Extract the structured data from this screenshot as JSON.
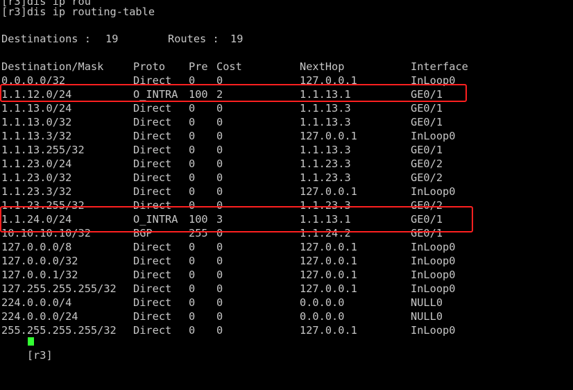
{
  "terminal": {
    "header_lines": [
      "[r3]dis ip rou",
      "[r3]dis ip routing-table"
    ],
    "summary": {
      "destinations_label": "Destinations : ",
      "destinations_value": "19",
      "routes_label": "Routes : ",
      "routes_value": "19"
    },
    "columns": {
      "dest": "Destination/Mask",
      "proto": "Proto",
      "pre": "Pre",
      "cost": "Cost",
      "nexthop": "NextHop",
      "interface": "Interface"
    },
    "rows": [
      {
        "dest": "0.0.0.0/32",
        "proto": "Direct",
        "pre": "0",
        "cost": "0",
        "nexthop": "127.0.0.1",
        "interface": "InLoop0"
      },
      {
        "dest": "1.1.12.0/24",
        "proto": "O_INTRA",
        "pre": "100",
        "cost": "2",
        "nexthop": "1.1.13.1",
        "interface": "GE0/1"
      },
      {
        "dest": "1.1.13.0/24",
        "proto": "Direct",
        "pre": "0",
        "cost": "0",
        "nexthop": "1.1.13.3",
        "interface": "GE0/1"
      },
      {
        "dest": "1.1.13.0/32",
        "proto": "Direct",
        "pre": "0",
        "cost": "0",
        "nexthop": "1.1.13.3",
        "interface": "GE0/1"
      },
      {
        "dest": "1.1.13.3/32",
        "proto": "Direct",
        "pre": "0",
        "cost": "0",
        "nexthop": "127.0.0.1",
        "interface": "InLoop0"
      },
      {
        "dest": "1.1.13.255/32",
        "proto": "Direct",
        "pre": "0",
        "cost": "0",
        "nexthop": "1.1.13.3",
        "interface": "GE0/1"
      },
      {
        "dest": "1.1.23.0/24",
        "proto": "Direct",
        "pre": "0",
        "cost": "0",
        "nexthop": "1.1.23.3",
        "interface": "GE0/2"
      },
      {
        "dest": "1.1.23.0/32",
        "proto": "Direct",
        "pre": "0",
        "cost": "0",
        "nexthop": "1.1.23.3",
        "interface": "GE0/2"
      },
      {
        "dest": "1.1.23.3/32",
        "proto": "Direct",
        "pre": "0",
        "cost": "0",
        "nexthop": "127.0.0.1",
        "interface": "InLoop0"
      },
      {
        "dest": "1.1.23.255/32",
        "proto": "Direct",
        "pre": "0",
        "cost": "0",
        "nexthop": "1.1.23.3",
        "interface": "GE0/2"
      },
      {
        "dest": "1.1.24.0/24",
        "proto": "O_INTRA",
        "pre": "100",
        "cost": "3",
        "nexthop": "1.1.13.1",
        "interface": "GE0/1"
      },
      {
        "dest": "10.10.10.10/32",
        "proto": "BGP",
        "pre": "255",
        "cost": "0",
        "nexthop": "1.1.24.2",
        "interface": "GE0/1"
      },
      {
        "dest": "127.0.0.0/8",
        "proto": "Direct",
        "pre": "0",
        "cost": "0",
        "nexthop": "127.0.0.1",
        "interface": "InLoop0"
      },
      {
        "dest": "127.0.0.0/32",
        "proto": "Direct",
        "pre": "0",
        "cost": "0",
        "nexthop": "127.0.0.1",
        "interface": "InLoop0"
      },
      {
        "dest": "127.0.0.1/32",
        "proto": "Direct",
        "pre": "0",
        "cost": "0",
        "nexthop": "127.0.0.1",
        "interface": "InLoop0"
      },
      {
        "dest": "127.255.255.255/32",
        "proto": "Direct",
        "pre": "0",
        "cost": "0",
        "nexthop": "127.0.0.1",
        "interface": "InLoop0"
      },
      {
        "dest": "224.0.0.0/4",
        "proto": "Direct",
        "pre": "0",
        "cost": "0",
        "nexthop": "0.0.0.0",
        "interface": "NULL0"
      },
      {
        "dest": "224.0.0.0/24",
        "proto": "Direct",
        "pre": "0",
        "cost": "0",
        "nexthop": "0.0.0.0",
        "interface": "NULL0"
      },
      {
        "dest": "255.255.255.255/32",
        "proto": "Direct",
        "pre": "0",
        "cost": "0",
        "nexthop": "127.0.0.1",
        "interface": "InLoop0"
      }
    ],
    "prompt": "[r3]",
    "highlighted_rows": [
      1,
      10
    ],
    "colors": {
      "background": "#000000",
      "text": "#c7c7c7",
      "highlight_border": "#ff2020",
      "cursor": "#33ff33"
    }
  }
}
